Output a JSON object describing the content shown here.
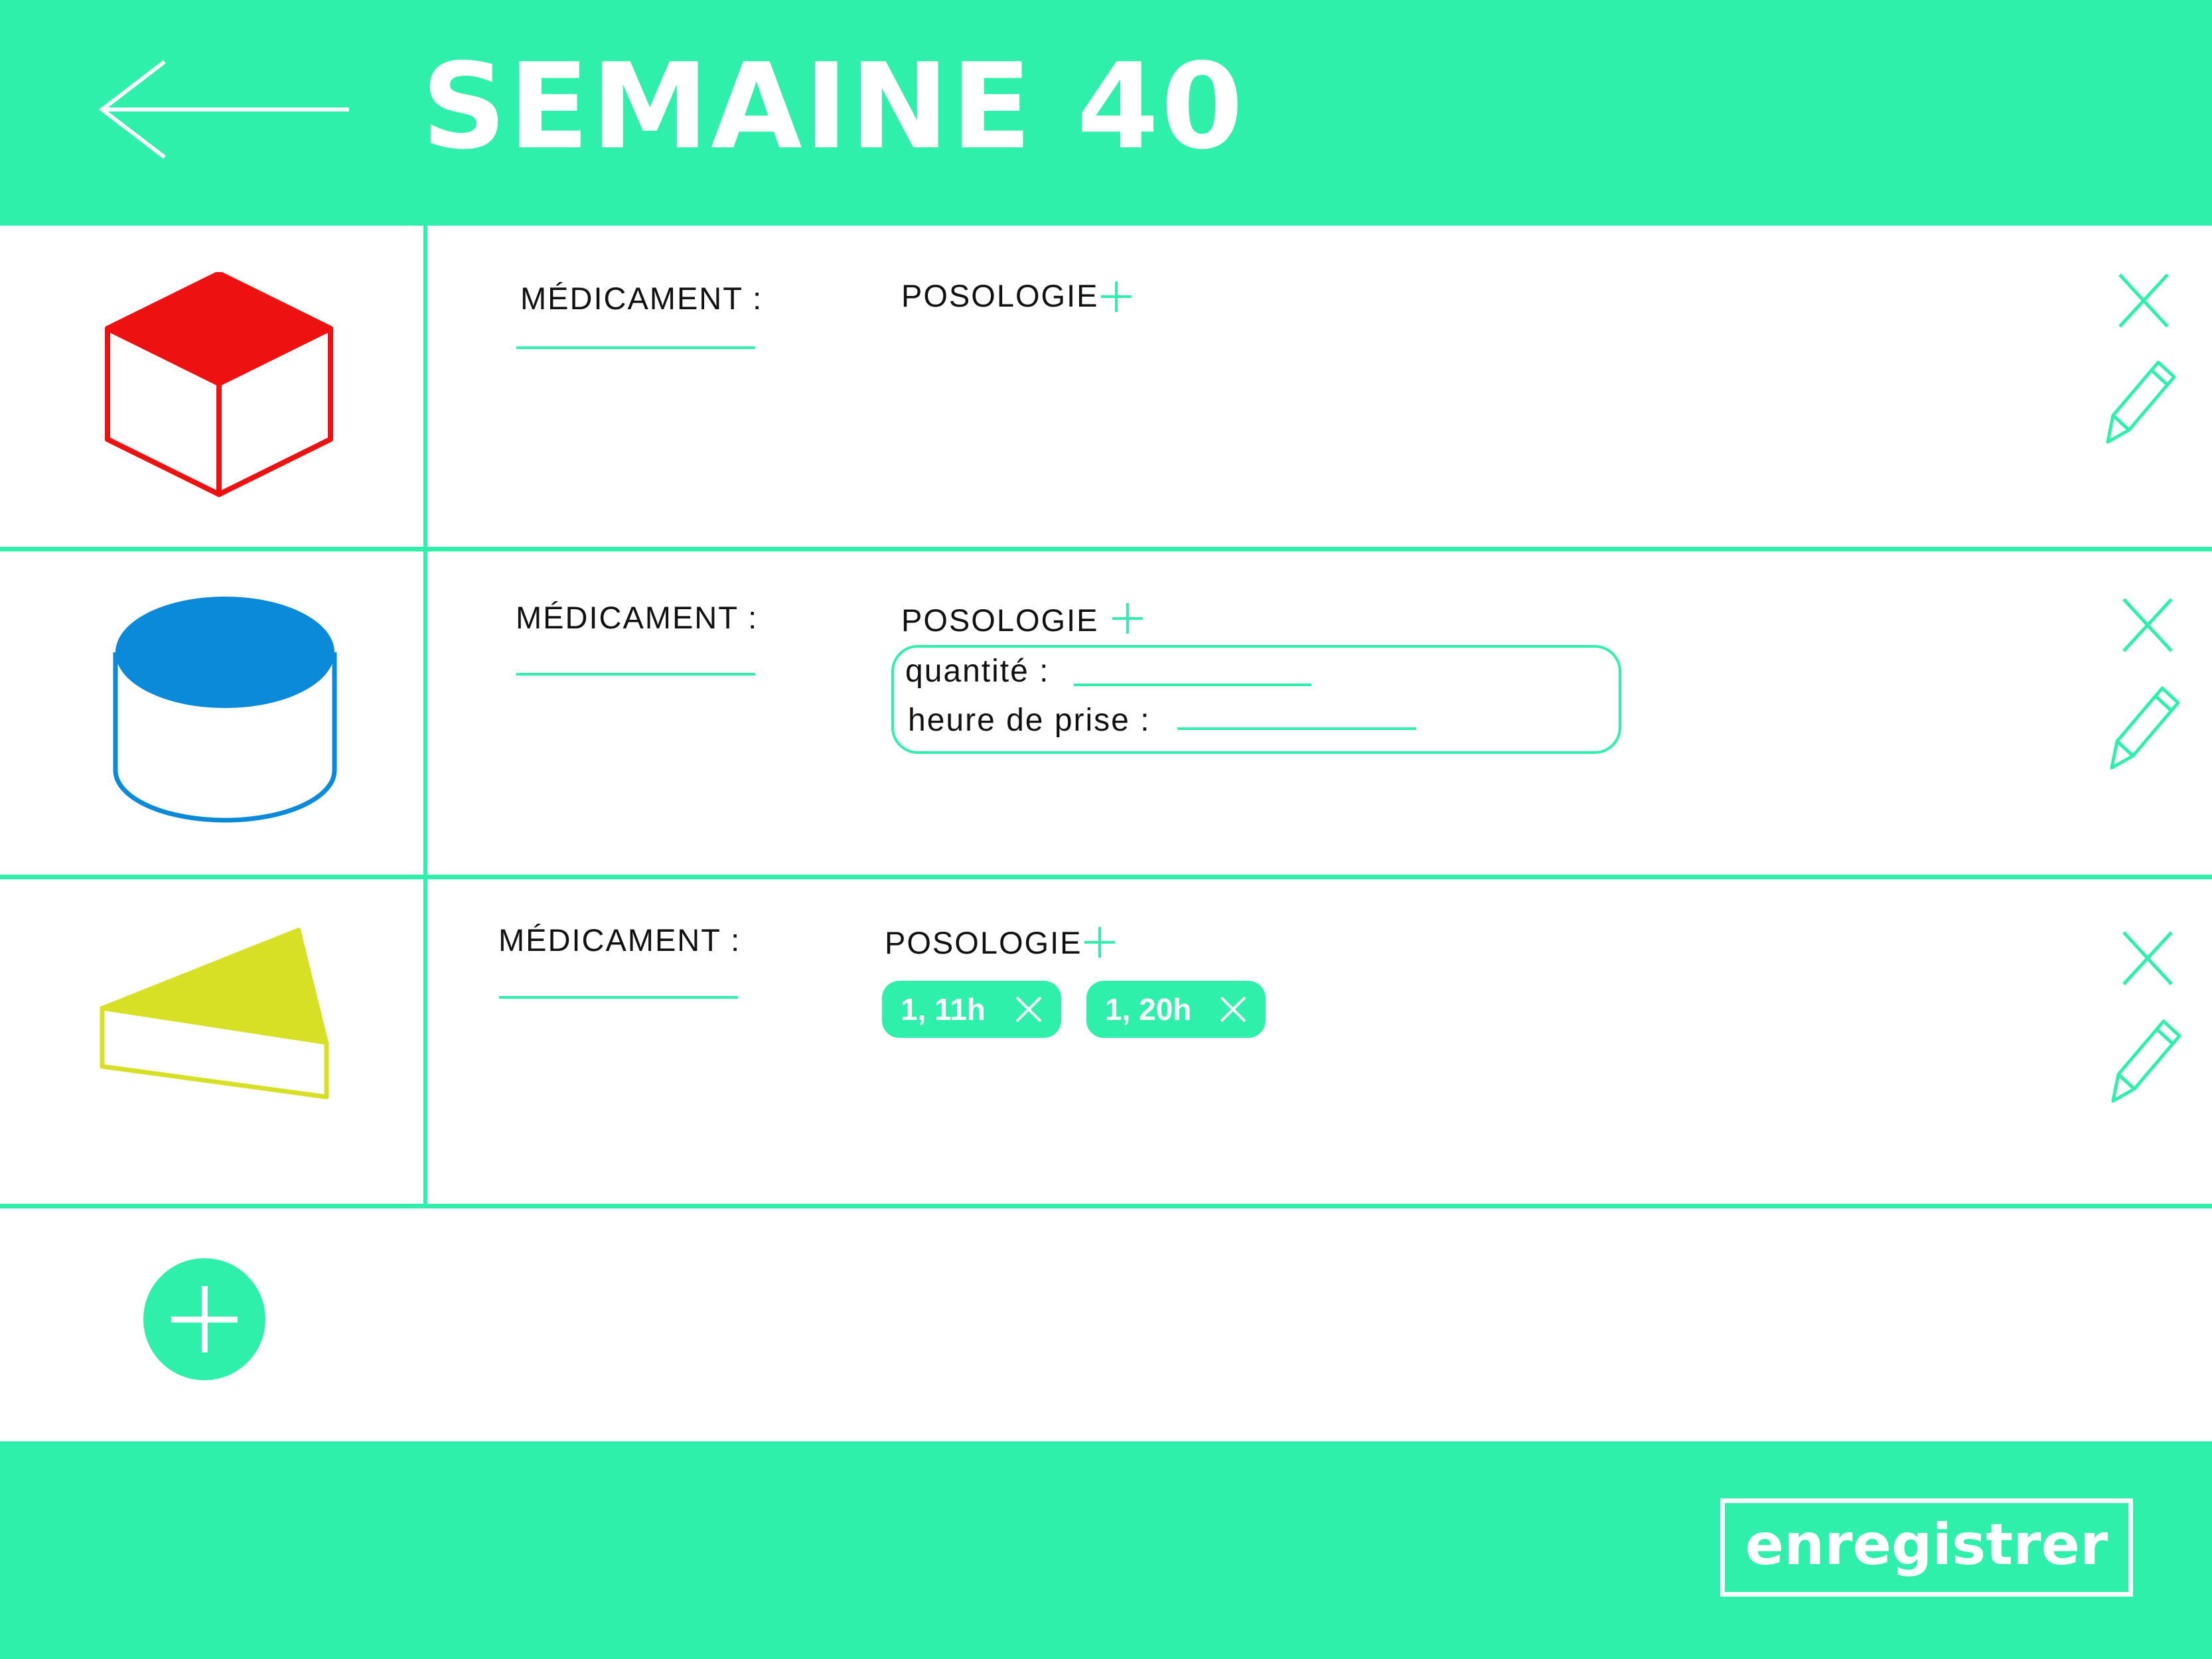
{
  "colors": {
    "accent": "#2ef0ab",
    "red": "#ee1111",
    "blue": "#0a8ad8",
    "yellow": "#d8e026"
  },
  "header": {
    "title": "SEMAINE 40",
    "back_icon": "arrow-left-icon"
  },
  "rows": [
    {
      "shape": "cube",
      "medicament_label": "MÉDICAMENT :",
      "posologie_label": "POSOLOGIE"
    },
    {
      "shape": "cylinder",
      "medicament_label": "MÉDICAMENT :",
      "posologie_label": "POSOLOGIE",
      "quantite_label": "quantité :",
      "heure_label": "heure de prise :"
    },
    {
      "shape": "triangular-prism",
      "medicament_label": "MÉDICAMENT :",
      "posologie_label": "POSOLOGIE",
      "chips": [
        "1, 11h",
        "1, 20h"
      ]
    }
  ],
  "footer": {
    "save_label": "enregistrer"
  }
}
